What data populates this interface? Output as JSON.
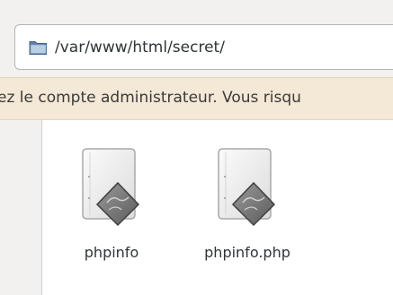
{
  "location": {
    "path": "/var/www/html/secret/",
    "icon": "folder-icon"
  },
  "infobar": {
    "message": "ez le compte administrateur. Vous risqu"
  },
  "files": [
    {
      "name": "phpinfo",
      "icon": "script-file-icon"
    },
    {
      "name": "phpinfo.php",
      "icon": "script-file-icon"
    }
  ]
}
